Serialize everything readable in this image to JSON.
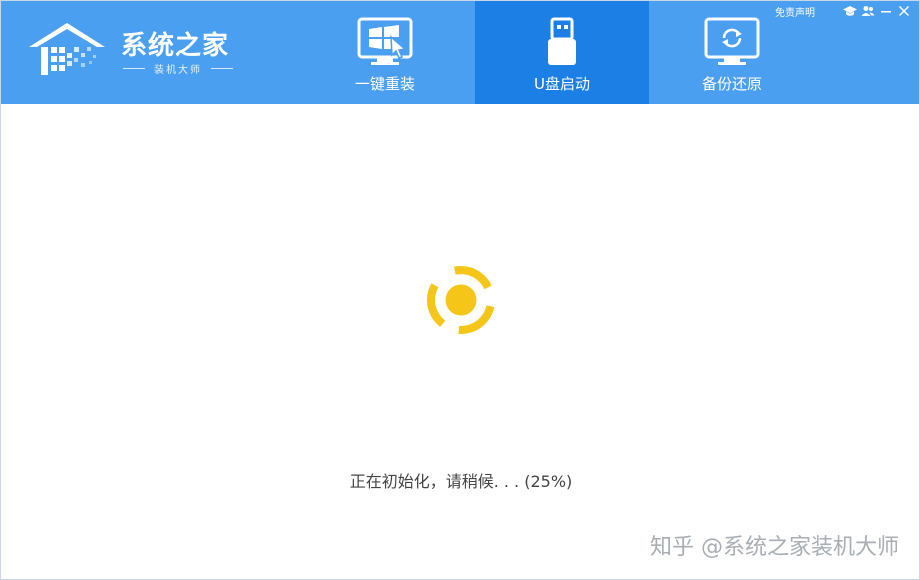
{
  "app": {
    "title": "系统之家",
    "subtitle": "装机大师"
  },
  "top_bar": {
    "disclaimer_label": "免责声明",
    "icons": [
      "graduation-cap-icon",
      "users-icon",
      "minimize-icon",
      "close-icon"
    ]
  },
  "nav": {
    "active_tab": "U盘启动",
    "tabs": [
      {
        "label": "一键重装",
        "icon": "windows-monitor-icon"
      },
      {
        "label": "U盘启动",
        "icon": "usb-drive-icon"
      },
      {
        "label": "备份还原",
        "icon": "backup-restore-icon"
      }
    ]
  },
  "main": {
    "status_text": "正在初始化，请稍候. . . (25%)",
    "progress_percent": 25
  },
  "watermark": {
    "text": "知乎 @系统之家装机大师"
  },
  "colors": {
    "header_bg": "#4b9ff0",
    "active_tab_bg": "#1b7fe6",
    "spinner_yellow": "#f5c518",
    "text_white": "#ffffff",
    "status_text": "#444444"
  }
}
